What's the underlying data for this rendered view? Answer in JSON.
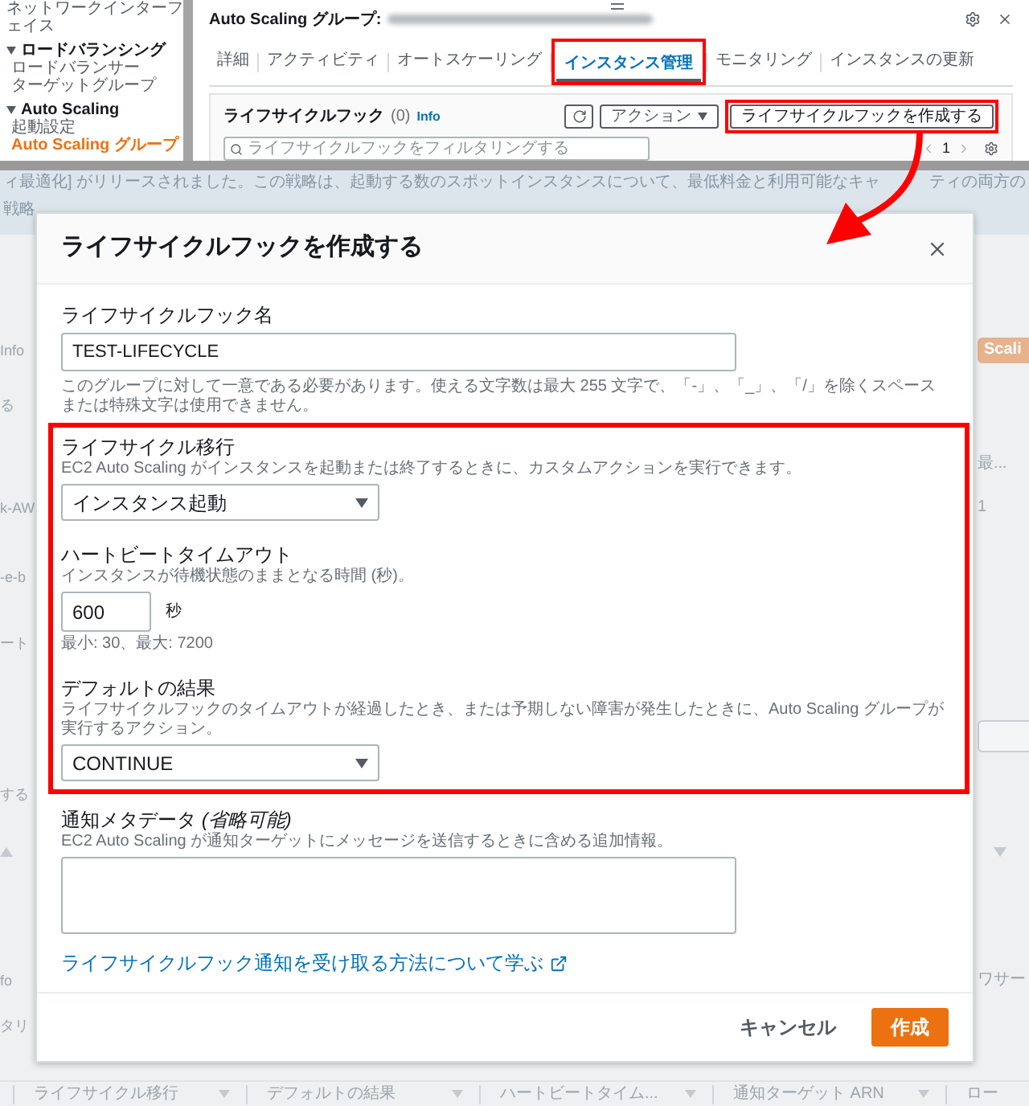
{
  "console": {
    "sidebar": [
      {
        "kind": "item",
        "label": "ネットワークインターフェイス",
        "selected": false
      },
      {
        "kind": "group",
        "label": "ロードバランシング",
        "expanded": true,
        "children": [
          {
            "label": "ロードバランサー",
            "selected": false
          },
          {
            "label": "ターゲットグループ",
            "selected": false
          }
        ]
      },
      {
        "kind": "group",
        "label": "Auto Scaling",
        "expanded": true,
        "children": [
          {
            "label": "起動設定",
            "selected": false
          },
          {
            "label": "Auto Scaling グループ",
            "selected": true
          }
        ]
      }
    ],
    "page_title": "Auto Scaling グループ:",
    "tabs": [
      {
        "label": "詳細",
        "selected": false,
        "highlighted": false
      },
      {
        "label": "アクティビティ",
        "selected": false,
        "highlighted": false
      },
      {
        "label": "オートスケーリング",
        "selected": false,
        "highlighted": false
      },
      {
        "label": "インスタンス管理",
        "selected": true,
        "highlighted": true
      },
      {
        "label": "モニタリング",
        "selected": false,
        "highlighted": false
      },
      {
        "label": "インスタンスの更新",
        "selected": false,
        "highlighted": false
      }
    ],
    "lifecycle_panel": {
      "title": "ライフサイクルフック",
      "count": "(0)",
      "info": "Info",
      "actions_button": "アクション",
      "create_button": {
        "label": "ライフサイクルフックを作成する",
        "highlighted": true
      },
      "filter_placeholder": "ライフサイクルフックをフィルタリングする",
      "page": "1"
    }
  },
  "background": {
    "banner": {
      "line_1": [
        "ィ最適化] がリリースされました。この戦略は、起動する数のスポットインスタンスについて、最低料金と利用可能なキャ",
        "ティの両方の"
      ],
      "line_2": "戦略"
    },
    "left_edge": [
      "Info",
      "る",
      "k-AW",
      "-e-b",
      "ート",
      "する",
      "fo",
      "タリ"
    ],
    "right_edge": [
      "Scali",
      "最...",
      "1",
      "ワサー"
    ],
    "table_columns": [
      "ライフサイクル移行",
      "デフォルトの結果",
      "ハートビートタイム...",
      "通知ターゲット ARN",
      "ロー"
    ]
  },
  "dialog": {
    "title": "ライフサイクルフックを作成する",
    "name_field": {
      "label": "ライフサイクルフック名",
      "value": "TEST-LIFECYCLE",
      "help": "このグループに対して一意である必要があります。使える文字数は最大 255 文字で、「-」、「_」、「/」を除くスペースまたは特殊文字は使用できません。"
    },
    "highlighted_section": {
      "highlighted": true,
      "fields": [
        {
          "kind": "select",
          "label": "ライフサイクル移行",
          "description": "EC2 Auto Scaling がインスタンスを起動または終了するときに、カスタムアクションを実行できます。",
          "value": "インスタンス起動"
        },
        {
          "kind": "number",
          "label": "ハートビートタイムアウト",
          "description": "インスタンスが待機状態のままとなる時間 (秒)。",
          "value": "600",
          "unit": "秒",
          "constraint": "最小: 30、最大: 7200"
        },
        {
          "kind": "select",
          "label": "デフォルトの結果",
          "description": "ライフサイクルフックのタイムアウトが経過したとき、または予期しない障害が発生したときに、Auto Scaling グループが実行するアクション。",
          "value": "CONTINUE"
        }
      ]
    },
    "metadata_field": {
      "label": "通知メタデータ *(省略可能)*",
      "description": "EC2 Auto Scaling が通知ターゲットにメッセージを送信するときに含める追加情報。"
    },
    "learn_link": "ライフサイクルフック通知を受け取る方法について学ぶ",
    "buttons": [
      {
        "kind": "secondary",
        "label": "キャンセル"
      },
      {
        "kind": "primary",
        "label": "作成"
      }
    ]
  }
}
